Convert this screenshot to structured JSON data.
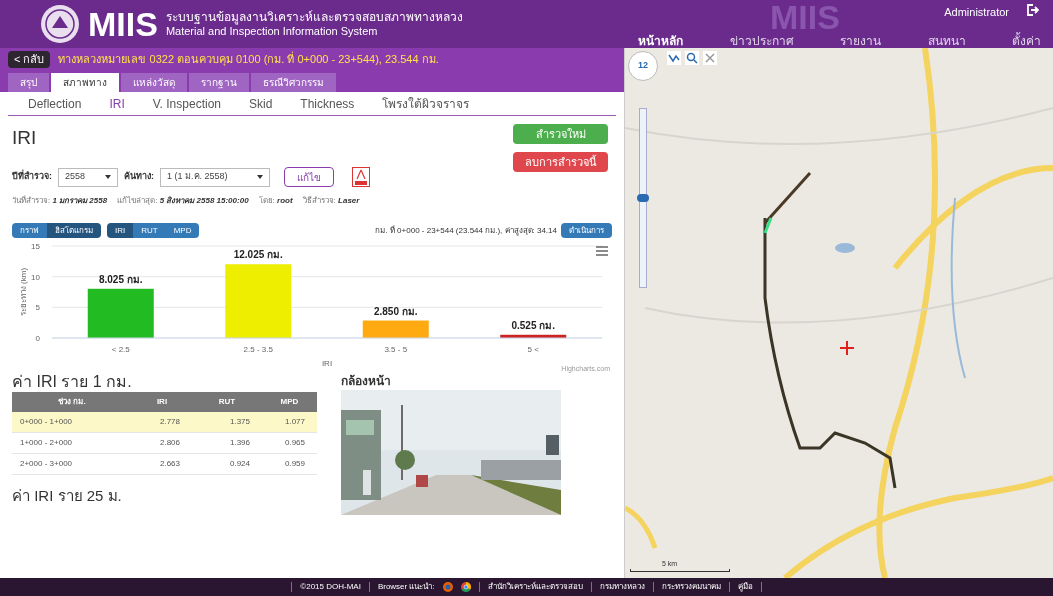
{
  "header": {
    "logo_text": "MIIS",
    "title_th": "ระบบฐานข้อมูลงานวิเคราะห์และตรวจสอบสภาพทางหลวง",
    "title_en": "Material and Inspection Information System",
    "bg_logo": "MIIS",
    "user": "Administrator"
  },
  "nav": [
    {
      "label": "หน้าหลัก",
      "selected": true
    },
    {
      "label": "ข่าวประกาศ",
      "selected": false
    },
    {
      "label": "รายงาน",
      "selected": false
    },
    {
      "label": "สนทนา",
      "selected": false
    },
    {
      "label": "ตั้งค่า",
      "selected": false
    }
  ],
  "back_button": "< กลับ",
  "route_title": "ทางหลวงหมายเลข 0322 ตอนควบคุม 0100 (กม. ที่ 0+000 - 23+544), 23.544 กม.",
  "tabs": [
    {
      "label": "สรุป",
      "selected": false
    },
    {
      "label": "สภาพทาง",
      "selected": true
    },
    {
      "label": "แหล่งวัสดุ",
      "selected": false
    },
    {
      "label": "รากฐาน",
      "selected": false
    },
    {
      "label": "ธรณีวิศวกรรม",
      "selected": false
    }
  ],
  "subtabs": [
    {
      "label": "Deflection",
      "selected": false
    },
    {
      "label": "IRI",
      "selected": true
    },
    {
      "label": "V. Inspection",
      "selected": false
    },
    {
      "label": "Skid",
      "selected": false
    },
    {
      "label": "Thickness",
      "selected": false
    },
    {
      "label": "โพรงใต้ผิวจราจร",
      "selected": false
    }
  ],
  "page_title": "IRI",
  "new_survey_button": "สำรวจใหม่",
  "delete_survey_button": "ลบการสำรวจนี้",
  "filters": [
    {
      "label": "ปีที่สำรวจ:",
      "value": "2558"
    },
    {
      "label": "ค้นทาง:",
      "value": "1 (1 ม.ค. 2558)"
    }
  ],
  "edit_button": "แก้ไข",
  "info": [
    {
      "label": "วันที่สำรวจ:",
      "value": "1 มกราคม 2558"
    },
    {
      "label": "แก้ไขล่าสุด:",
      "value": "5 สิงหาคม 2558 15:00:00"
    },
    {
      "label": "โดย:",
      "value": "root"
    },
    {
      "label": "วิธีสำรวจ:",
      "value": "Laser"
    }
  ],
  "view_buttons": [
    {
      "label": "กราฟ",
      "selected": false
    },
    {
      "label": "ฮิสโตแกรม",
      "selected": true
    }
  ],
  "metric_buttons": [
    {
      "label": "IRI",
      "selected": true
    },
    {
      "label": "RUT",
      "selected": false
    },
    {
      "label": "MPD",
      "selected": false
    }
  ],
  "range_summary": "กม. ที่ 0+000 - 23+544 (23.544 กม.), ค่าสูงสุด: 34.14",
  "action_button": "ดำเนินการ",
  "chart_data": {
    "type": "bar",
    "xlabel": "IRI",
    "ylabel": "ระยะทาง (km)",
    "categories": [
      "< 2.5",
      "2.5 - 3.5",
      "3.5 - 5",
      "5 <"
    ],
    "stacked": true,
    "series": [
      {
        "color": "#22bb22",
        "values": [
          8.025,
          null,
          null,
          null
        ]
      },
      {
        "color": "#eeee00",
        "values": [
          null,
          12.025,
          null,
          null
        ]
      },
      {
        "color": "#ffaa11",
        "values": [
          null,
          null,
          2.85,
          null
        ]
      },
      {
        "color": "#cc2222",
        "values": [
          null,
          null,
          null,
          0.525
        ]
      }
    ],
    "ylim": [
      0,
      15
    ],
    "yticks": [
      0,
      5,
      10,
      15
    ],
    "value_labels": [
      "8.025 กม.",
      "12.025 กม.",
      "2.850 กม.",
      "0.525 กม."
    ]
  },
  "chart_credit": "Highcharts.com",
  "table_title": "ค่า IRI ราย 1 กม.",
  "table": {
    "columns": [
      "ช่วง กม.",
      "IRI",
      "RUT",
      "MPD"
    ],
    "rows": [
      {
        "cells": [
          "0+000 - 1+000",
          "2.778",
          "1.375",
          "1.077"
        ],
        "selected": true
      },
      {
        "cells": [
          "1+000 - 2+000",
          "2.806",
          "1.396",
          "0.965"
        ],
        "selected": false
      },
      {
        "cells": [
          "2+000 - 3+000",
          "2.663",
          "0.924",
          "0.959"
        ],
        "selected": false
      }
    ]
  },
  "next_title": "ค่า IRI ราย 25 ม.",
  "camera_title": "กล้องหน้า",
  "map": {
    "zoom_level": "12",
    "zoom_slider": {
      "level": 0.5
    },
    "scale": "5 km"
  },
  "footer": [
    "©2015 DOH-MAI",
    "Browser แนะนำ:",
    "สำนักวิเคราะห์และตรวจสอบ",
    "กรมทางหลวง",
    "กระทรวงคมนาคม",
    "คู่มือ"
  ]
}
